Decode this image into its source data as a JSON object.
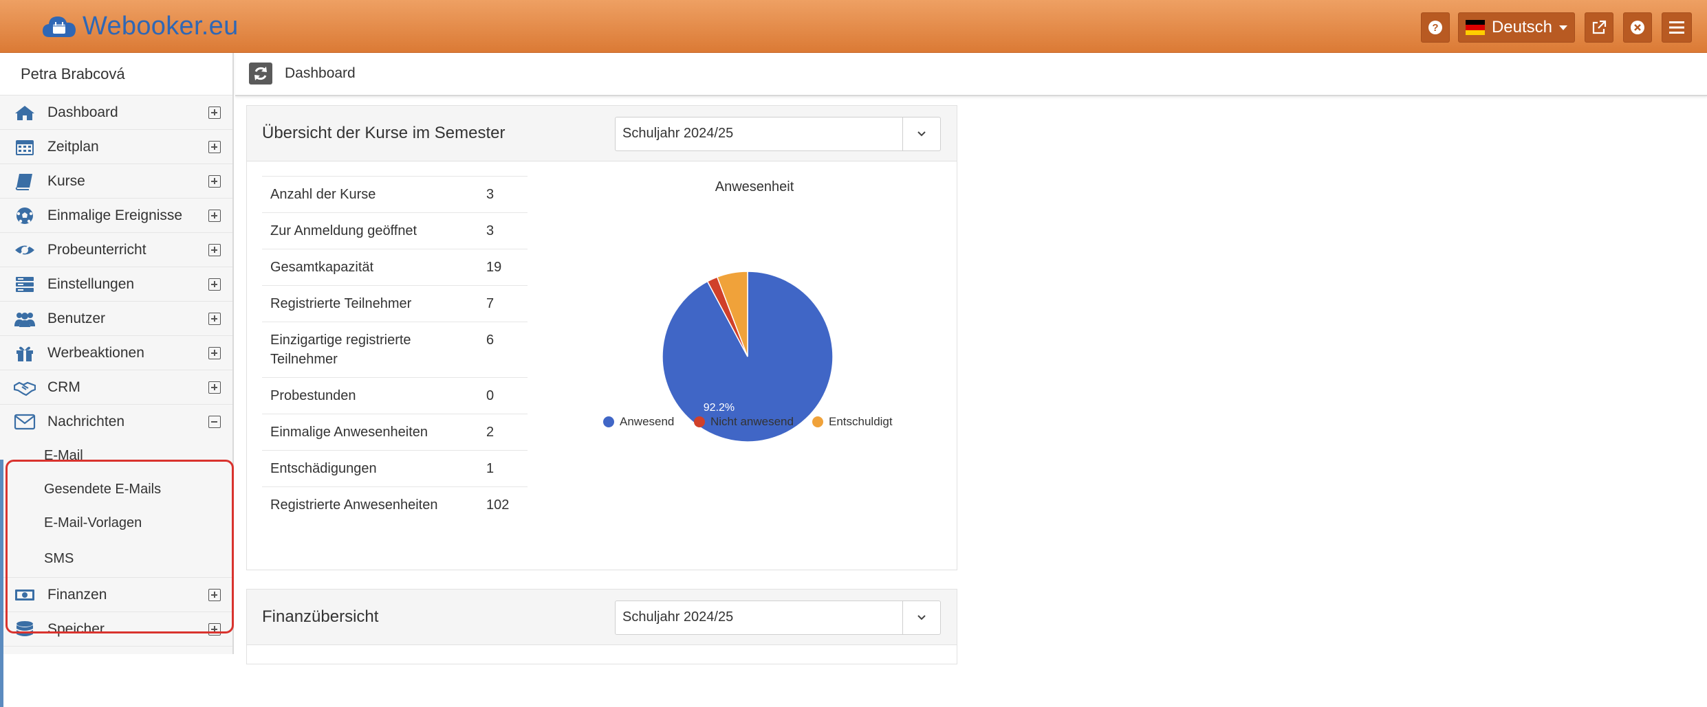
{
  "header": {
    "brand": "Webooker.eu",
    "language": "Deutsch",
    "colors": {
      "bar": "#e58a47",
      "brand_text": "#2f67b5",
      "button": "#b85a22"
    }
  },
  "sidebar": {
    "user": "Petra Brabcová",
    "items": [
      {
        "label": "Dashboard",
        "icon": "home-icon"
      },
      {
        "label": "Zeitplan",
        "icon": "calendar-icon"
      },
      {
        "label": "Kurse",
        "icon": "book-icon"
      },
      {
        "label": "Einmalige Ereignisse",
        "icon": "soccer-ball-icon"
      },
      {
        "label": "Probeunterricht",
        "icon": "eye-slash-icon"
      },
      {
        "label": "Einstellungen",
        "icon": "server-icon"
      },
      {
        "label": "Benutzer",
        "icon": "users-icon"
      },
      {
        "label": "Werbeaktionen",
        "icon": "gift-icon"
      },
      {
        "label": "CRM",
        "icon": "handshake-icon"
      },
      {
        "label": "Nachrichten",
        "icon": "envelope-icon"
      }
    ],
    "sub_items": [
      "E-Mail",
      "Gesendete E-Mails",
      "E-Mail-Vorlagen",
      "SMS"
    ],
    "bottom_items": [
      {
        "label": "Finanzen",
        "icon": "money-icon"
      },
      {
        "label": "Speicher",
        "icon": "database-icon"
      }
    ]
  },
  "breadcrumb": {
    "current": "Dashboard"
  },
  "courses_panel": {
    "title": "Übersicht der Kurse im Semester",
    "select_value": "Schuljahr 2024/25",
    "rows": [
      {
        "label": "Anzahl der Kurse",
        "value": "3"
      },
      {
        "label": "Zur Anmeldung geöffnet",
        "value": "3"
      },
      {
        "label": "Gesamtkapazität",
        "value": "19"
      },
      {
        "label": "Registrierte Teilnehmer",
        "value": "7"
      },
      {
        "label": "Einzigartige registrierte Teilnehmer",
        "value": "6"
      },
      {
        "label": "Probestunden",
        "value": "0"
      },
      {
        "label": "Einmalige Anwesenheiten",
        "value": "2"
      },
      {
        "label": "Entschädigungen",
        "value": "1"
      },
      {
        "label": "Registrierte Anwesenheiten",
        "value": "102"
      }
    ]
  },
  "chart_data": {
    "type": "pie",
    "title": "Anwesenheit",
    "categories": [
      "Anwesend",
      "Nicht anwesend",
      "Entschuldigt"
    ],
    "values": [
      92.2,
      2.0,
      5.8
    ],
    "colors": [
      "#4066c6",
      "#d0402a",
      "#f0a23a"
    ],
    "data_labels": [
      "92.2%",
      "",
      ""
    ],
    "legend_position": "bottom"
  },
  "finance_panel": {
    "title": "Finanzübersicht",
    "select_value": "Schuljahr 2024/25"
  }
}
